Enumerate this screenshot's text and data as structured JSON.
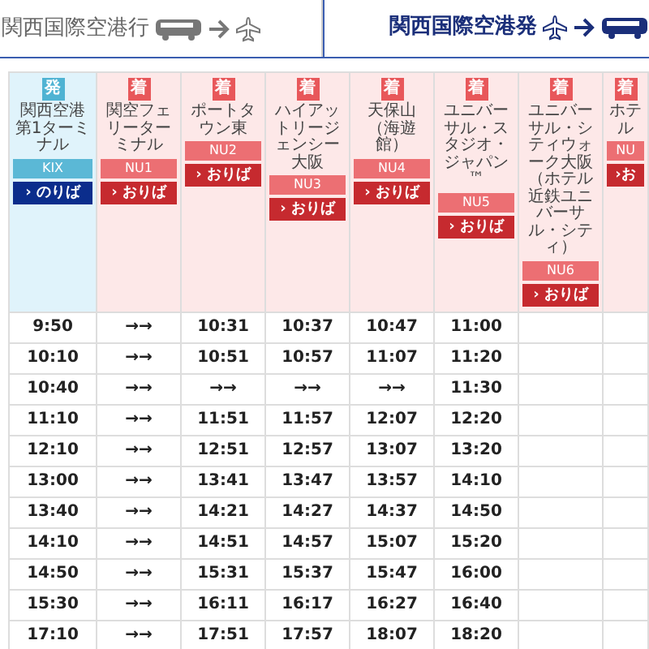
{
  "tabs": [
    {
      "label": "関西国際空港行",
      "kind": "inbound",
      "selected": false
    },
    {
      "label": "関西国際空港発",
      "kind": "outbound",
      "selected": true
    }
  ],
  "columns": [
    {
      "kind": "departure",
      "badge": "発",
      "title": "関西空港第1ターミナル",
      "code": "KIX",
      "button": "› のりば"
    },
    {
      "kind": "arrival",
      "badge": "着",
      "title": "関空フェリーターミナル",
      "code": "NU1",
      "button": "› おりば"
    },
    {
      "kind": "arrival",
      "badge": "着",
      "title": "ポートタウン東",
      "code": "NU2",
      "button": "› おりば"
    },
    {
      "kind": "arrival",
      "badge": "着",
      "title": "ハイアットリージェンシー大阪",
      "code": "NU3",
      "button": "› おりば"
    },
    {
      "kind": "arrival",
      "badge": "着",
      "title": "天保山（海遊館）",
      "code": "NU4",
      "button": "› おりば"
    },
    {
      "kind": "arrival",
      "badge": "着",
      "title": "ユニバーサル・スタジオ・ジャパン™",
      "code": "NU5",
      "button": "› おりば"
    },
    {
      "kind": "arrival",
      "badge": "着",
      "title": "ユニバーサル・シティウォーク大阪（ホテル近鉄ユニバーサル・シティ）",
      "code": "NU6",
      "button": "› おりば"
    },
    {
      "kind": "arrival",
      "badge": "着",
      "title": "ホテル",
      "code": "NU",
      "button": "›お"
    }
  ],
  "rows": [
    [
      "9:50",
      "→→",
      "10:31",
      "10:37",
      "10:47",
      "11:00"
    ],
    [
      "10:10",
      "→→",
      "10:51",
      "10:57",
      "11:07",
      "11:20"
    ],
    [
      "10:40",
      "→→",
      "→→",
      "→→",
      "→→",
      "11:30"
    ],
    [
      "11:10",
      "→→",
      "11:51",
      "11:57",
      "12:07",
      "12:20"
    ],
    [
      "12:10",
      "→→",
      "12:51",
      "12:57",
      "13:07",
      "13:20"
    ],
    [
      "13:00",
      "→→",
      "13:41",
      "13:47",
      "13:57",
      "14:10"
    ],
    [
      "13:40",
      "→→",
      "14:21",
      "14:27",
      "14:37",
      "14:50"
    ],
    [
      "14:10",
      "→→",
      "14:51",
      "14:57",
      "15:07",
      "15:20"
    ],
    [
      "14:50",
      "→→",
      "15:31",
      "15:37",
      "15:47",
      "16:00"
    ],
    [
      "15:30",
      "→→",
      "16:11",
      "16:17",
      "16:27",
      "16:40"
    ],
    [
      "17:10",
      "→→",
      "17:51",
      "17:57",
      "18:07",
      "18:20"
    ]
  ]
}
